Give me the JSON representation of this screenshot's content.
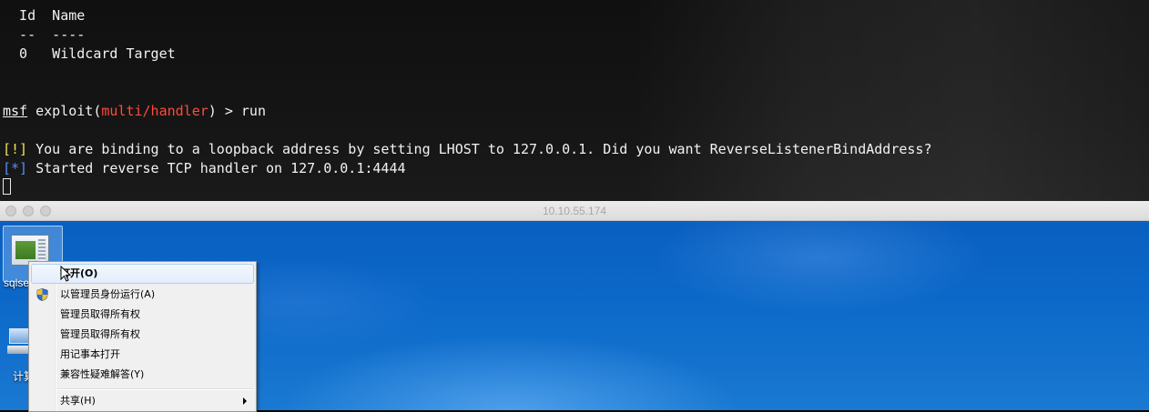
{
  "terminal": {
    "lines": {
      "header_cols": "  Id  Name",
      "header_rule": "  --  ----",
      "target_row": "  0   Wildcard Target",
      "prompt": {
        "msf": "msf",
        "exploit_open": " exploit(",
        "module": "multi/handler",
        "exploit_close": ") > run"
      },
      "warn": {
        "tag": "[!]",
        "text": " You are binding to a loopback address by setting LHOST to 127.0.0.1. Did you want ReverseListenerBindAddress?"
      },
      "info": {
        "tag": "[*]",
        "text": " Started reverse TCP handler on 127.0.0.1:4444"
      }
    },
    "colors": {
      "module": "#ff4b3a",
      "warn_tag": "#f3e256",
      "info_tag": "#5a8ff0",
      "text": "#f2f2f2"
    }
  },
  "remote_window": {
    "title": "10.10.55.174"
  },
  "desktop": {
    "icons": [
      {
        "label": "sqlse",
        "icon": "application-window-icon"
      },
      {
        "label": "计算",
        "icon": "computer-icon"
      }
    ],
    "background_color": "#0b68c8"
  },
  "context_menu": {
    "items": [
      {
        "label": "打开(O)",
        "bold": true,
        "highlighted": true
      },
      {
        "label": "以管理员身份运行(A)",
        "icon": "uac-shield-icon"
      },
      {
        "label": "管理员取得所有权"
      },
      {
        "label": "管理员取得所有权"
      },
      {
        "label": "用记事本打开"
      },
      {
        "label": "兼容性疑难解答(Y)"
      },
      {
        "label": "共享(H)",
        "has_submenu": true
      }
    ]
  }
}
